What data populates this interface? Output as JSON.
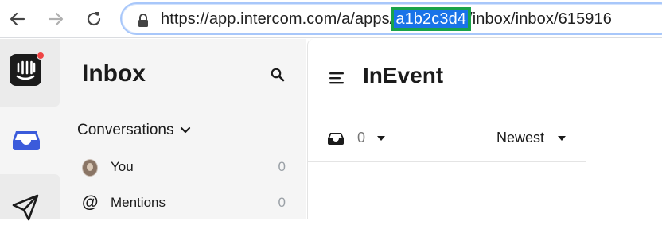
{
  "browser": {
    "url_prefix": "https://app.intercom.com/a/apps/",
    "url_selected": "a1b2c3d4",
    "url_suffix": "/inbox/inbox/615916",
    "icons": {
      "back": "arrow-left-icon",
      "forward": "arrow-right-icon",
      "reload": "reload-icon",
      "lock": "lock-icon"
    }
  },
  "rail": {
    "logo": "intercom-logo-icon",
    "items": [
      {
        "icon": "inbox-tray-icon",
        "active": true
      },
      {
        "icon": "paper-plane-icon"
      }
    ],
    "colors": {
      "active": "#3b5bdb",
      "notification": "#ef4444"
    }
  },
  "sidebar": {
    "title": "Inbox",
    "search_icon": "search-icon",
    "section_label": "Conversations",
    "items": [
      {
        "label": "You",
        "count": "0",
        "icon": "avatar"
      },
      {
        "label": "Mentions",
        "count": "0",
        "icon": "at-icon"
      }
    ]
  },
  "list": {
    "title": "InEvent",
    "menu_icon": "hamburger-menu-icon",
    "filter_count": "0",
    "sort_label": "Newest"
  }
}
